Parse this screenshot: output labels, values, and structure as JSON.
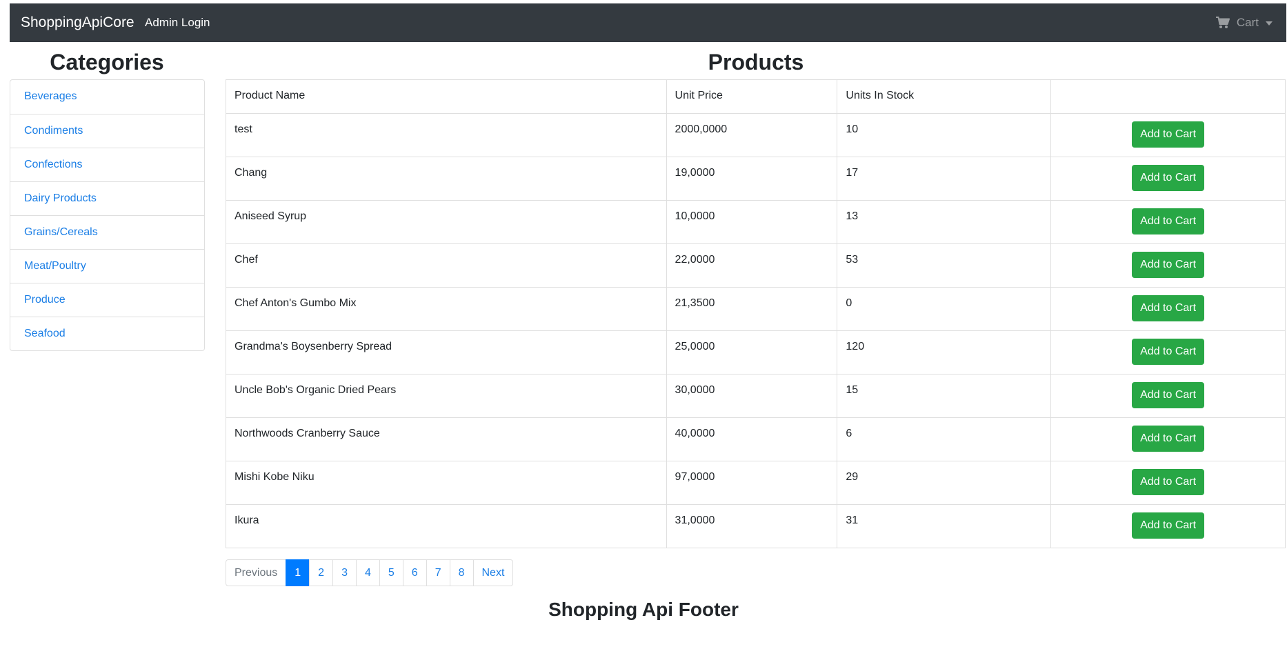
{
  "navbar": {
    "brand": "ShoppingApiCore",
    "admin_login": "Admin Login",
    "cart_label": "Cart",
    "cart_icon": "shopping-cart-icon"
  },
  "categories": {
    "title": "Categories",
    "items": [
      {
        "label": "Beverages"
      },
      {
        "label": "Condiments"
      },
      {
        "label": "Confections"
      },
      {
        "label": "Dairy Products"
      },
      {
        "label": "Grains/Cereals"
      },
      {
        "label": "Meat/Poultry"
      },
      {
        "label": "Produce"
      },
      {
        "label": "Seafood"
      }
    ]
  },
  "products": {
    "title": "Products",
    "columns": {
      "name": "Product Name",
      "price": "Unit Price",
      "stock": "Units In Stock",
      "action": ""
    },
    "add_to_cart_label": "Add to Cart",
    "rows": [
      {
        "name": "test",
        "price": "2000,0000",
        "stock": "10"
      },
      {
        "name": "Chang",
        "price": "19,0000",
        "stock": "17"
      },
      {
        "name": "Aniseed Syrup",
        "price": "10,0000",
        "stock": "13"
      },
      {
        "name": "Chef",
        "price": "22,0000",
        "stock": "53"
      },
      {
        "name": "Chef Anton's Gumbo Mix",
        "price": "21,3500",
        "stock": "0"
      },
      {
        "name": "Grandma's Boysenberry Spread",
        "price": "25,0000",
        "stock": "120"
      },
      {
        "name": "Uncle Bob's Organic Dried Pears",
        "price": "30,0000",
        "stock": "15"
      },
      {
        "name": "Northwoods Cranberry Sauce",
        "price": "40,0000",
        "stock": "6"
      },
      {
        "name": "Mishi Kobe Niku",
        "price": "97,0000",
        "stock": "29"
      },
      {
        "name": "Ikura",
        "price": "31,0000",
        "stock": "31"
      }
    ]
  },
  "pagination": {
    "previous": "Previous",
    "next": "Next",
    "pages": [
      "1",
      "2",
      "3",
      "4",
      "5",
      "6",
      "7",
      "8"
    ],
    "active_page": "1"
  },
  "footer": {
    "text": "Shopping Api Footer"
  },
  "colors": {
    "navbar_bg": "#343a40",
    "link": "#1a7ee6",
    "button_green": "#28a745",
    "active_page": "#007bff"
  }
}
